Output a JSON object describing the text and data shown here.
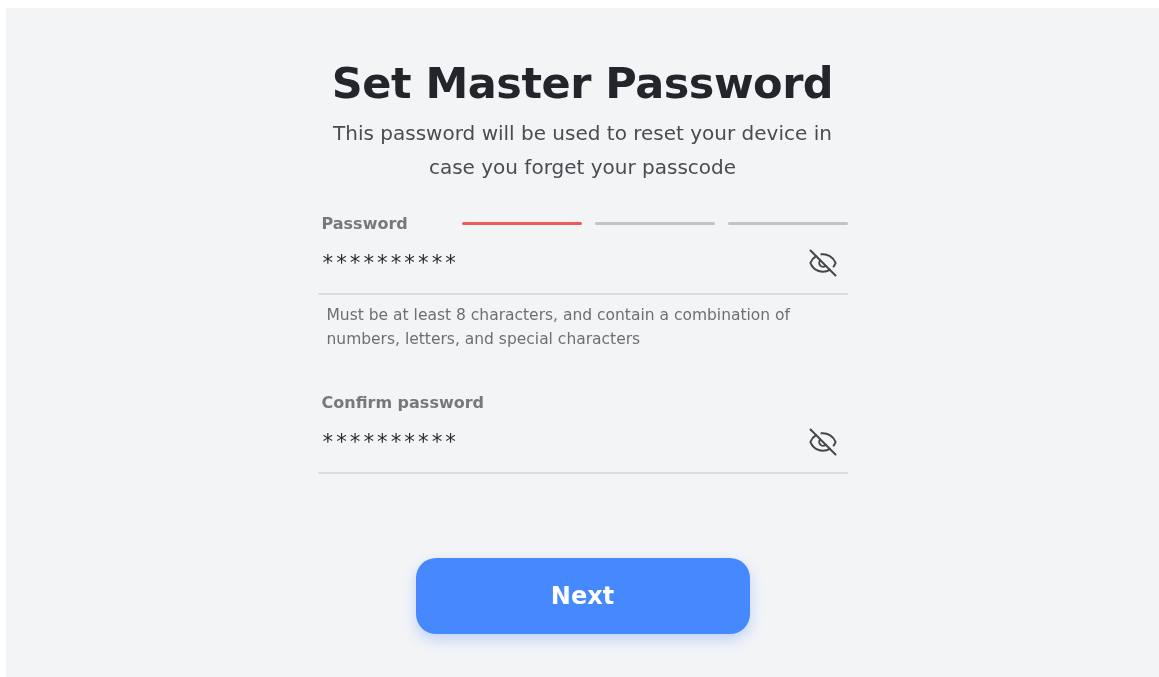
{
  "title": "Set Master Password",
  "subtitle": "This password will be used to reset your device in case you forget your passcode",
  "fields": [
    {
      "label": "Password",
      "value": "**********",
      "revealed": false,
      "strength": [
        {
          "filled": true
        },
        {
          "filled": false
        },
        {
          "filled": false
        }
      ],
      "helper": "Must be at least 8 characters, and contain a combination of numbers, letters, and special characters"
    },
    {
      "label": "Confirm password",
      "value": "**********",
      "revealed": false
    }
  ],
  "button": "Next"
}
